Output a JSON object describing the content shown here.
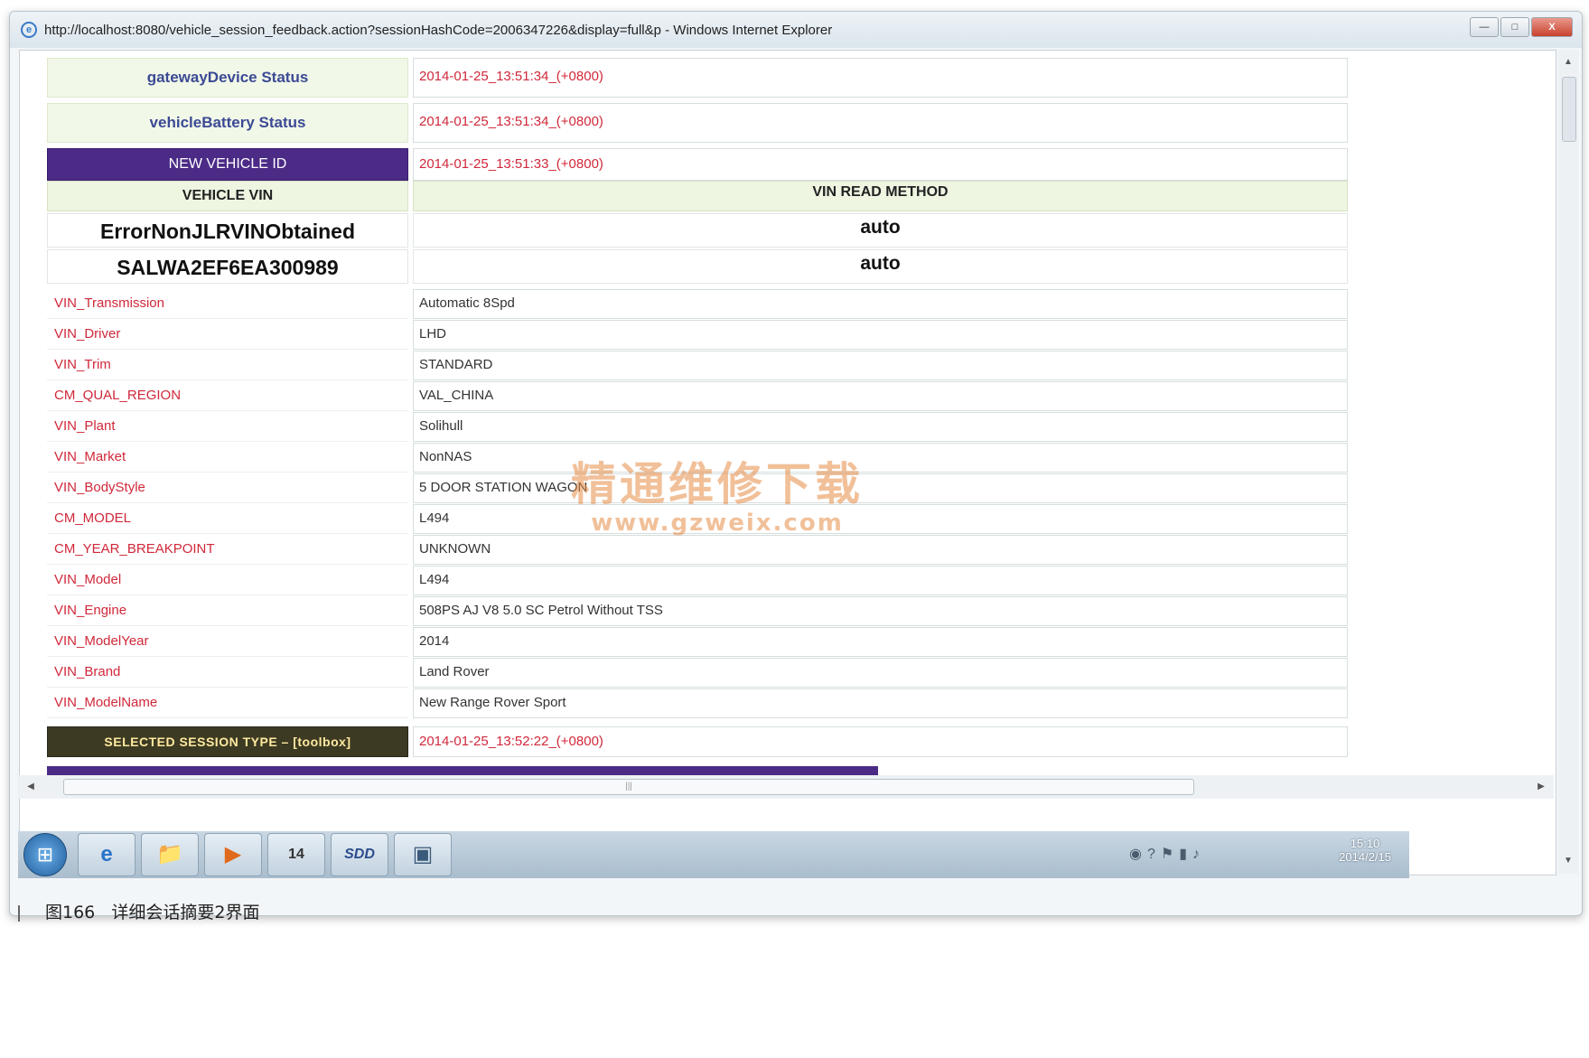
{
  "window": {
    "title": "http://localhost:8080/vehicle_session_feedback.action?sessionHashCode=2006347226&display=full&p - Windows Internet Explorer",
    "controls": {
      "minimize": "—",
      "maximize": "□",
      "close": "X"
    }
  },
  "status_rows": [
    {
      "label": "gatewayDevice Status",
      "value": "2014-01-25_13:51:34_(+0800)"
    },
    {
      "label": "vehicleBattery Status",
      "value": "2014-01-25_13:51:34_(+0800)"
    }
  ],
  "new_vehicle": {
    "header": "NEW VEHICLE ID",
    "timestamp": "2014-01-25_13:51:33_(+0800)",
    "col_vin": "VEHICLE VIN",
    "col_method": "VIN READ METHOD",
    "vins": [
      {
        "vin": "ErrorNonJLRVINObtained",
        "method": "auto"
      },
      {
        "vin": "SALWA2EF6EA300989",
        "method": "auto"
      }
    ]
  },
  "properties": [
    {
      "key": "VIN_Transmission",
      "value": "Automatic 8Spd"
    },
    {
      "key": "VIN_Driver",
      "value": "LHD"
    },
    {
      "key": "VIN_Trim",
      "value": "STANDARD"
    },
    {
      "key": "CM_QUAL_REGION",
      "value": "VAL_CHINA"
    },
    {
      "key": "VIN_Plant",
      "value": "Solihull"
    },
    {
      "key": "VIN_Market",
      "value": "NonNAS"
    },
    {
      "key": "VIN_BodyStyle",
      "value": "5 DOOR STATION WAGON"
    },
    {
      "key": "CM_MODEL",
      "value": "L494"
    },
    {
      "key": "CM_YEAR_BREAKPOINT",
      "value": "UNKNOWN"
    },
    {
      "key": "VIN_Model",
      "value": "L494"
    },
    {
      "key": "VIN_Engine",
      "value": "508PS AJ V8 5.0 SC Petrol Without TSS"
    },
    {
      "key": "VIN_ModelYear",
      "value": "2014"
    },
    {
      "key": "VIN_Brand",
      "value": "Land Rover"
    },
    {
      "key": "VIN_ModelName",
      "value": "New Range Rover Sport"
    }
  ],
  "session_type": {
    "header": "SELECTED SESSION TYPE – [toolbox]",
    "timestamp": "2014-01-25_13:52:22_(+0800)"
  },
  "watermark": {
    "text": "精通维修下载",
    "url": "www.gzweix.com"
  },
  "taskbar": {
    "items": [
      {
        "name": "ie-icon",
        "label": "e"
      },
      {
        "name": "folder-icon",
        "label": "📁"
      },
      {
        "name": "media-player-icon",
        "label": "▶"
      },
      {
        "name": "calendar-app-icon",
        "label": "14"
      },
      {
        "name": "sdd-icon",
        "label": "SDD"
      },
      {
        "name": "remote-app-icon",
        "label": "▣"
      }
    ],
    "clock_time": "15:10",
    "clock_date": "2014/2/15"
  },
  "caption": {
    "figure": "图166",
    "text": "详细会话摘要2界面"
  },
  "colors": {
    "accent_purple": "#4b2b86",
    "label_red": "#d0283a",
    "status_blue": "#3b4a94"
  }
}
